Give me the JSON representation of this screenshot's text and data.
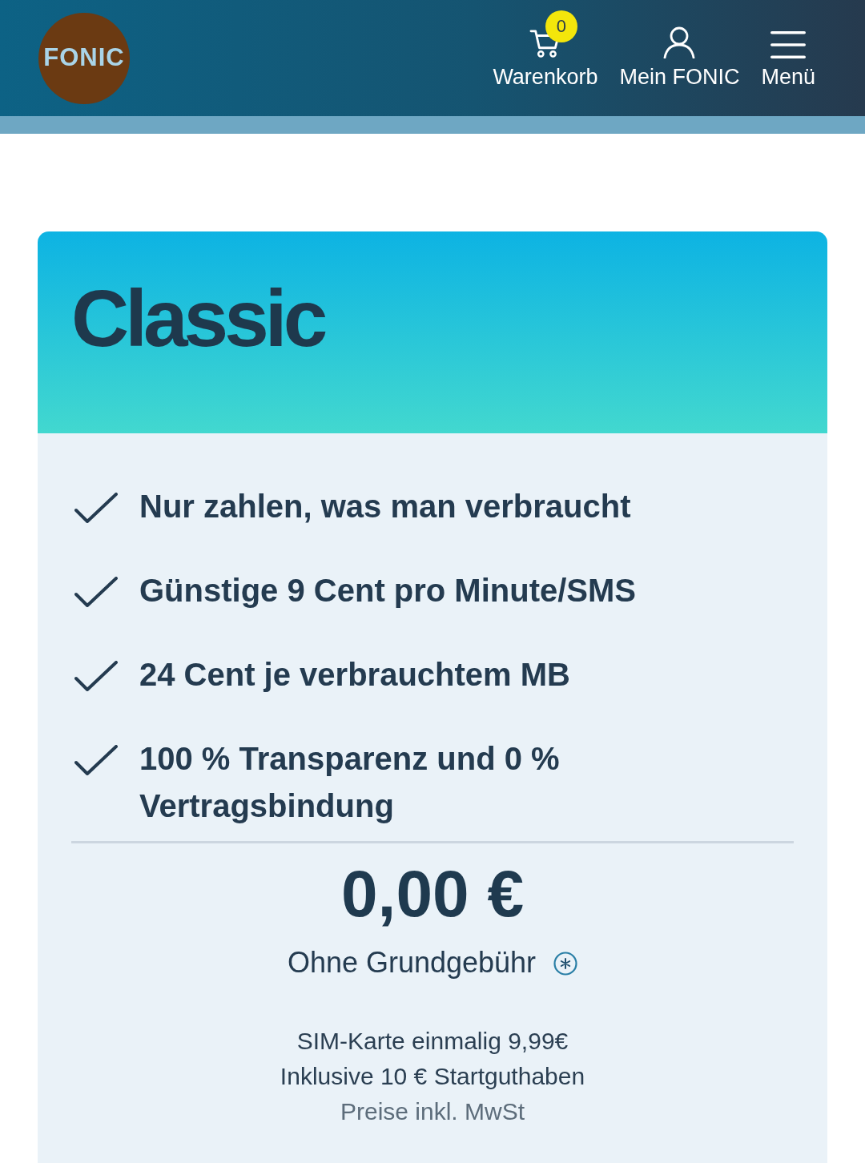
{
  "header": {
    "logo": "FONIC",
    "nav": [
      {
        "kind": "cart",
        "label": "Warenkorb",
        "badge": "0"
      },
      {
        "kind": "account",
        "label": "Mein FONIC"
      },
      {
        "kind": "menu",
        "label": "Menü"
      }
    ]
  },
  "plan": {
    "title": "Classic",
    "features": [
      "Nur zahlen, was man verbraucht",
      "Günstige 9 Cent pro Minute/SMS",
      "24 Cent je verbrauchtem MB",
      "100 % Transparenz und 0 % Vertragsbindung"
    ],
    "price": "0,00 €",
    "price_note": "Ohne Grundgebühr",
    "details": [
      "SIM-Karte einmalig 9,99€",
      "Inklusive 10 € Startguthaben"
    ],
    "tax_note": "Preise inkl. MwSt"
  }
}
